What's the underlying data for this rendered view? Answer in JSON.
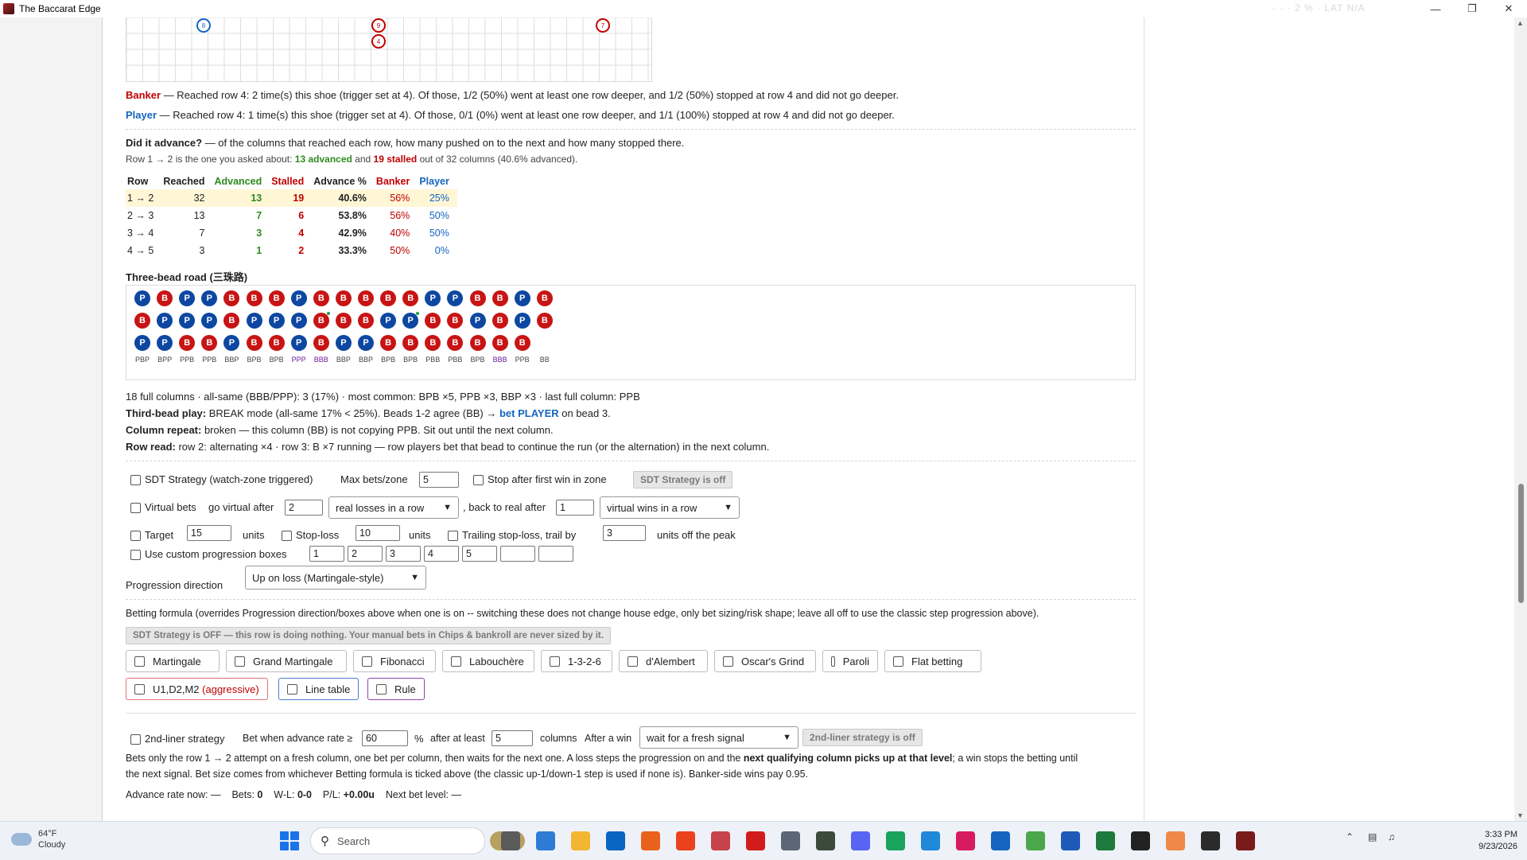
{
  "window": {
    "title": "The Baccarat Edge",
    "ghost_text": "· · ·  2 %  ·  LAT  N/A"
  },
  "big_road": {
    "marks": [
      "8",
      "9",
      "4",
      "7"
    ]
  },
  "summary": {
    "banker_label": "Banker",
    "banker_text": " — Reached row 4: 2 time(s) this shoe (trigger set at 4). Of those, 1/2 (50%) went at least one row deeper, and 1/2 (50%) stopped at row 4 and did not go deeper.",
    "player_label": "Player",
    "player_text": " — Reached row 4: 1 time(s) this shoe (trigger set at 4). Of those, 0/1 (0%) went at least one row deeper, and 1/1 (100%) stopped at row 4 and did not go deeper."
  },
  "advance": {
    "heading": "Did it advance?",
    "heading_rest": " — of the columns that reached each row, how many pushed on to the next and how many stopped there.",
    "sub_a": "Row 1 → 2 is the one you asked about: ",
    "sub_adv": "13 advanced",
    "sub_and": " and ",
    "sub_stall": "19 stalled",
    "sub_b": " out of 32 columns (40.6% advanced).",
    "headers": [
      "Row",
      "Reached",
      "Advanced",
      "Stalled",
      "Advance %",
      "Banker",
      "Player"
    ],
    "rows": [
      [
        "1 → 2",
        "32",
        "13",
        "19",
        "40.6%",
        "56%",
        "25%"
      ],
      [
        "2 → 3",
        "13",
        "7",
        "6",
        "53.8%",
        "56%",
        "50%"
      ],
      [
        "3 → 4",
        "7",
        "3",
        "4",
        "42.9%",
        "40%",
        "50%"
      ],
      [
        "4 → 5",
        "3",
        "1",
        "2",
        "33.3%",
        "50%",
        "0%"
      ]
    ]
  },
  "three_bead": {
    "title": "Three-bead road (三珠路)",
    "columns": [
      {
        "beads": [
          "P",
          "B",
          "P"
        ],
        "label": "PBP"
      },
      {
        "beads": [
          "B",
          "P",
          "P"
        ],
        "label": "BPP"
      },
      {
        "beads": [
          "P",
          "P",
          "B"
        ],
        "label": "PPB"
      },
      {
        "beads": [
          "P",
          "P",
          "B"
        ],
        "label": "PPB"
      },
      {
        "beads": [
          "B",
          "B",
          "P"
        ],
        "label": "BBP"
      },
      {
        "beads": [
          "B",
          "P",
          "B"
        ],
        "label": "BPB"
      },
      {
        "beads": [
          "B",
          "P",
          "B"
        ],
        "label": "BPB"
      },
      {
        "beads": [
          "P",
          "P",
          "P"
        ],
        "label": "PPP"
      },
      {
        "beads": [
          "B",
          "B",
          "B"
        ],
        "label": "BBB"
      },
      {
        "beads": [
          "B",
          "B",
          "P"
        ],
        "label": "BBP"
      },
      {
        "beads": [
          "B",
          "B",
          "P"
        ],
        "label": "BBP"
      },
      {
        "beads": [
          "B",
          "P",
          "B"
        ],
        "label": "BPB"
      },
      {
        "beads": [
          "B",
          "P",
          "B"
        ],
        "label": "BPB"
      },
      {
        "beads": [
          "P",
          "B",
          "B"
        ],
        "label": "PBB"
      },
      {
        "beads": [
          "P",
          "B",
          "B"
        ],
        "label": "PBB"
      },
      {
        "beads": [
          "B",
          "P",
          "B"
        ],
        "label": "BPB"
      },
      {
        "beads": [
          "B",
          "B",
          "B"
        ],
        "label": "BBB"
      },
      {
        "beads": [
          "P",
          "P",
          "B"
        ],
        "label": "PPB"
      },
      {
        "beads": [
          "B",
          "B"
        ],
        "label": "BB"
      }
    ]
  },
  "analysis": {
    "line1": "18 full columns · all-same (BBB/PPP): 3 (17%) · most common: BPB ×5, PPB ×3, BBP ×3 · last full column: PPB",
    "tb_label": "Third-bead play:",
    "tb_text": " BREAK mode (all-same 17% < 25%). Beads 1-2 agree (BB) → ",
    "tb_bet": "bet PLAYER",
    "tb_end": " on bead 3.",
    "cr_label": "Column repeat:",
    "cr_text": " broken — this column (BB) is not copying PPB. Sit out until the next column.",
    "rr_label": "Row read:",
    "rr_text": " row 2: alternating ×4 · row 3: B ×7 running — row players bet that bead to continue the run (or the alternation) in the next column."
  },
  "controls": {
    "sdt_label": "SDT Strategy (watch-zone triggered)",
    "max_bets_label": "Max bets/zone",
    "max_bets_value": "5",
    "stop_first_win": "Stop after first win in zone",
    "sdt_status": "SDT Strategy is off",
    "virtual_label": "Virtual bets",
    "go_virtual": "go virtual after",
    "go_virtual_value": "2",
    "real_losses": "real losses in a row",
    "back_real": ", back to real after",
    "back_real_value": "1",
    "virtual_wins": "virtual wins in a row",
    "target_label": "Target",
    "target_value": "15",
    "units": "units",
    "stoploss_label": "Stop-loss",
    "stoploss_value": "10",
    "trailing_label": "Trailing stop-loss, trail by",
    "trailing_value": "3",
    "units_peak": "units off the peak",
    "custom_prog": "Use custom progression boxes",
    "prog_boxes": [
      "1",
      "2",
      "3",
      "4",
      "5",
      "",
      ""
    ],
    "prog_dir_label": "Progression direction",
    "prog_dir_value": "Up on loss (Martingale-style)"
  },
  "formula": {
    "intro": "Betting formula (overrides Progression direction/boxes above when one is on -- switching these does not change house edge, only bet sizing/risk shape; leave all off to use the classic step progression above).",
    "banner": "SDT Strategy is OFF — this row is doing nothing. Your manual bets in Chips & bankroll are never sized by it.",
    "buttons": [
      "Martingale",
      "Grand Martingale",
      "Fibonacci",
      "Labouchère",
      "1-3-2-6",
      "d'Alembert",
      "Oscar's Grind",
      "Paroli",
      "Flat betting"
    ],
    "u1_label": "U1,D2,M2",
    "u1_extra": "(aggressive)",
    "line_table": "Line table",
    "rule": "Rule"
  },
  "second_liner": {
    "label": "2nd-liner strategy",
    "bet_when": "Bet when advance rate ≥",
    "rate_value": "60",
    "pct": "%",
    "after_least": "after at least",
    "cols_value": "5",
    "columns": "columns",
    "after_win": "After a win",
    "after_win_value": "wait for a fresh signal",
    "status": "2nd-liner strategy is off",
    "desc_a": "Bets only the row 1 → 2 attempt on a fresh column, one bet per column, then waits for the next one. A loss steps the progression on and the ",
    "desc_bold": "next qualifying column picks up at that level",
    "desc_b": "; a win stops the betting until",
    "desc_c": "the next signal. Bet size comes from whichever Betting formula is ticked above (the classic up-1/down-1 step is used if none is). Banker-side wins pay 0.95.",
    "rate_now_label": "Advance rate now:",
    "rate_now": "—",
    "bets_label": "Bets:",
    "bets": "0",
    "wl_label": "W-L:",
    "wl": "0-0",
    "pl_label": "P/L:",
    "pl": "+0.00u",
    "next_label": "Next bet level:",
    "next": "—"
  },
  "taskbar": {
    "temp": "64°F",
    "condition": "Cloudy",
    "search": "Search",
    "time": "3:33 PM",
    "date": "9/23/2026"
  },
  "colors": {
    "banker": "#c00000",
    "player": "#1565c0",
    "advanced": "#2e8b1f"
  }
}
